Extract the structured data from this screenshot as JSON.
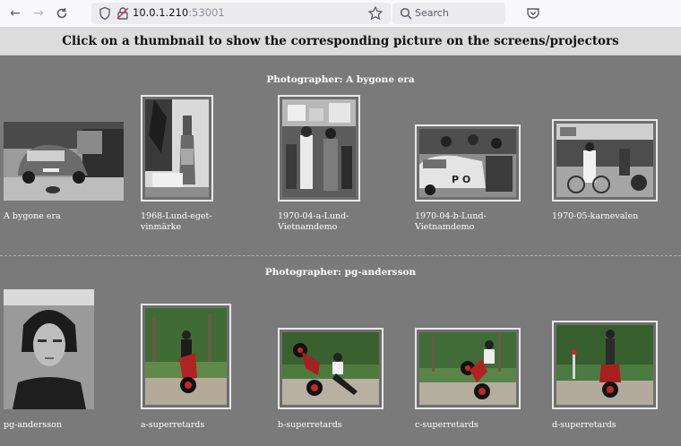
{
  "browser": {
    "url_host": "10.0.1.210",
    "url_port": ":53001",
    "search_placeholder": "Search"
  },
  "page": {
    "header": "Click on a thumbnail to show the corresponding picture on the screens/projectors"
  },
  "sections": [
    {
      "title": "Photographer: A bygone era",
      "items": [
        {
          "caption": "A bygone era"
        },
        {
          "caption": "1968-Lund-eget-vinmärke"
        },
        {
          "caption": "1970-04-a-Lund-Vietnamdemo"
        },
        {
          "caption": "1970-04-b-Lund-Vietnamdemo"
        },
        {
          "caption": "1970-05-karnevalen"
        }
      ]
    },
    {
      "title": "Photographer: pg-andersson",
      "items": [
        {
          "caption": "pg-andersson"
        },
        {
          "caption": "a-superretards"
        },
        {
          "caption": "b-superretards"
        },
        {
          "caption": "c-superretards"
        },
        {
          "caption": "d-superretards"
        }
      ]
    }
  ]
}
